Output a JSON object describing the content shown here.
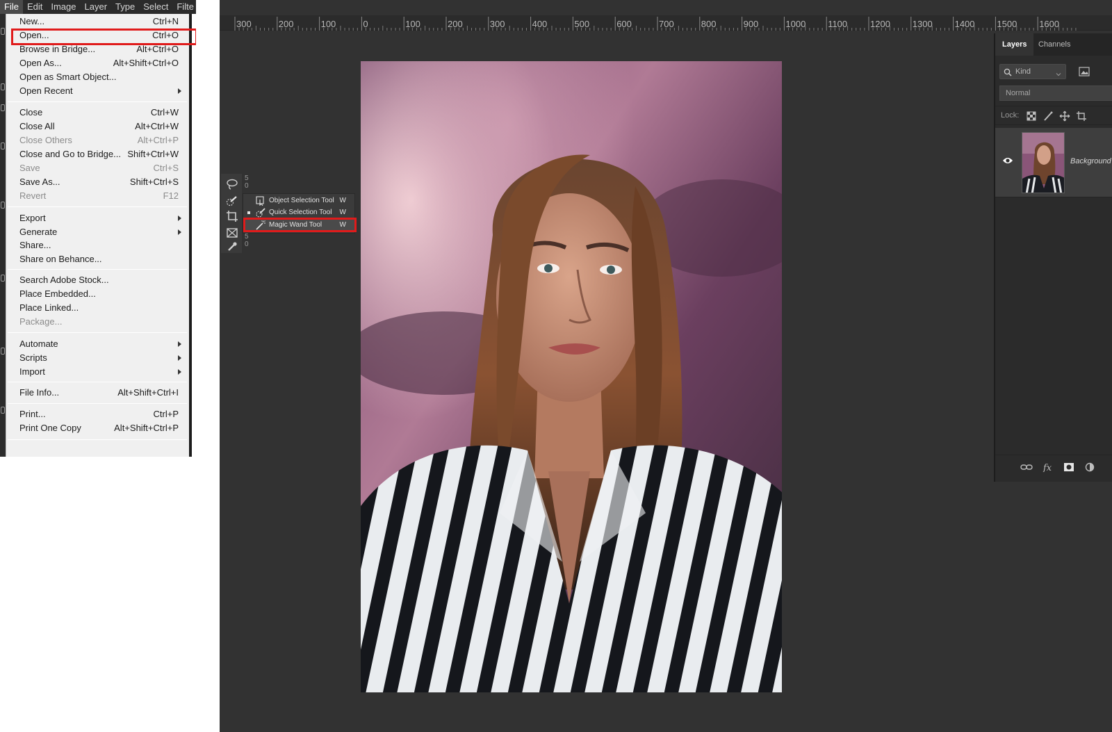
{
  "menubar": {
    "items": [
      "File",
      "Edit",
      "Image",
      "Layer",
      "Type",
      "Select",
      "Filte"
    ],
    "active": "File"
  },
  "file_menu": {
    "items": [
      {
        "label": "New...",
        "shortcut": "Ctrl+N"
      },
      {
        "label": "Open...",
        "shortcut": "Ctrl+O",
        "highlighted": true
      },
      {
        "label": "Browse in Bridge...",
        "shortcut": "Alt+Ctrl+O"
      },
      {
        "label": "Open As...",
        "shortcut": "Alt+Shift+Ctrl+O"
      },
      {
        "label": "Open as Smart Object...",
        "shortcut": ""
      },
      {
        "label": "Open Recent",
        "shortcut": "",
        "submenu": true
      },
      {
        "label": "Close",
        "shortcut": "Ctrl+W"
      },
      {
        "label": "Close All",
        "shortcut": "Alt+Ctrl+W"
      },
      {
        "label": "Close Others",
        "shortcut": "Alt+Ctrl+P",
        "disabled": true
      },
      {
        "label": "Close and Go to Bridge...",
        "shortcut": "Shift+Ctrl+W"
      },
      {
        "label": "Save",
        "shortcut": "Ctrl+S",
        "disabled": true
      },
      {
        "label": "Save As...",
        "shortcut": "Shift+Ctrl+S"
      },
      {
        "label": "Revert",
        "shortcut": "F12",
        "disabled": true
      },
      {
        "label": "Export",
        "shortcut": "",
        "submenu": true
      },
      {
        "label": "Generate",
        "shortcut": "",
        "submenu": true
      },
      {
        "label": "Share...",
        "shortcut": ""
      },
      {
        "label": "Share on Behance...",
        "shortcut": ""
      },
      {
        "label": "Search Adobe Stock...",
        "shortcut": ""
      },
      {
        "label": "Place Embedded...",
        "shortcut": ""
      },
      {
        "label": "Place Linked...",
        "shortcut": ""
      },
      {
        "label": "Package...",
        "shortcut": "",
        "disabled": true
      },
      {
        "label": "Automate",
        "shortcut": "",
        "submenu": true
      },
      {
        "label": "Scripts",
        "shortcut": "",
        "submenu": true
      },
      {
        "label": "Import",
        "shortcut": "",
        "submenu": true
      },
      {
        "label": "File Info...",
        "shortcut": "Alt+Shift+Ctrl+I"
      },
      {
        "label": "Print...",
        "shortcut": "Ctrl+P"
      },
      {
        "label": "Print One Copy",
        "shortcut": "Alt+Shift+Ctrl+P"
      }
    ]
  },
  "ruler": {
    "labels": [
      "300",
      "200",
      "100",
      "0",
      "100",
      "200",
      "300",
      "400",
      "500",
      "600",
      "700",
      "800",
      "900",
      "1000",
      "1100",
      "1200",
      "1300",
      "1400",
      "1500",
      "1600"
    ]
  },
  "toolbar": {
    "group_numbers": [
      "5",
      "0",
      "5",
      "0"
    ]
  },
  "tool_flyout": {
    "items": [
      {
        "label": "Object Selection Tool",
        "key": "W"
      },
      {
        "label": "Quick Selection Tool",
        "key": "W",
        "active": true
      },
      {
        "label": "Magic Wand Tool",
        "key": "W",
        "highlighted": true
      }
    ]
  },
  "layers_panel": {
    "tabs": [
      "Layers",
      "Channels"
    ],
    "active_tab": "Layers",
    "kind_placeholder": "Kind",
    "blend_mode": "Normal",
    "lock_label": "Lock:",
    "layer_name": "Background",
    "footer_icons": [
      "link-icon",
      "fx-icon",
      "mask-icon",
      "adjustment-icon"
    ]
  },
  "highlight_color": "#e01b1b"
}
